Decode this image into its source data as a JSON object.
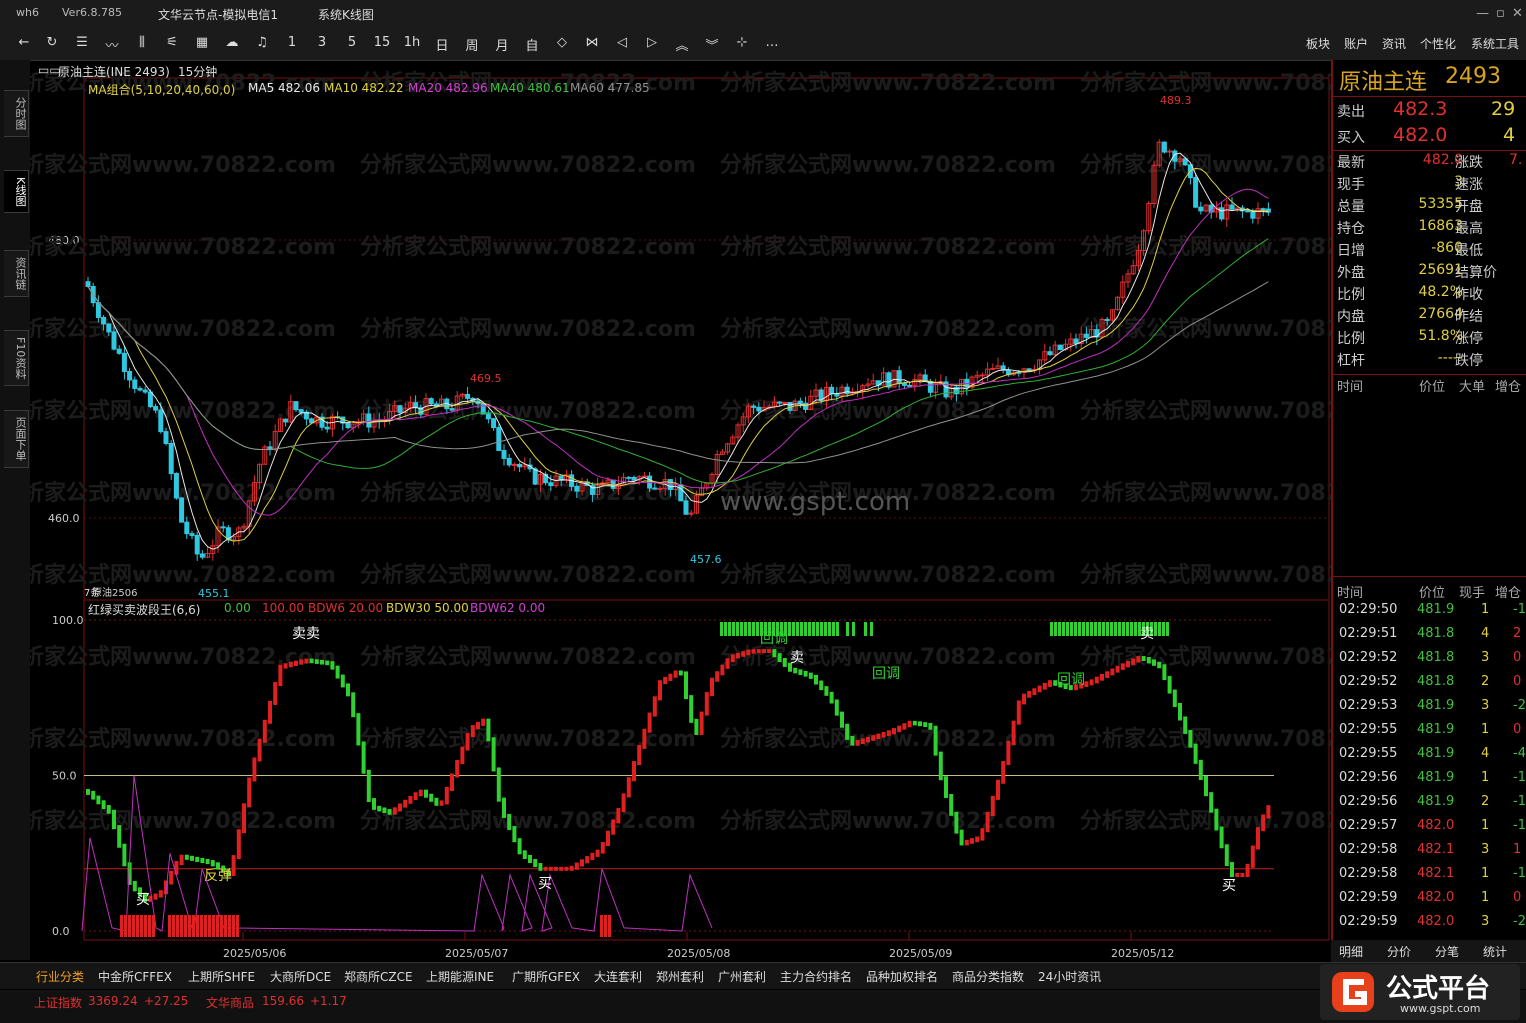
{
  "titlebar": {
    "app": "wh6",
    "version": "Ver6.8.785",
    "server": "文华云节点-模拟电信1",
    "window": "系统K线图"
  },
  "toolbar": {
    "icons": [
      "back-icon",
      "refresh-icon",
      "list-icon",
      "line-chart-icon",
      "candle-icon",
      "tick-icon",
      "grid-icon",
      "cloud-icon",
      "bell-icon"
    ],
    "periods": [
      "1",
      "3",
      "5",
      "15",
      "1h",
      "日",
      "周",
      "月",
      "自"
    ],
    "menu": [
      "板块",
      "账户",
      "资讯",
      "个性化",
      "系统工具"
    ]
  },
  "sidetabs": [
    "分时图",
    "K线图",
    "资讯链",
    "F10资料",
    "页面下单"
  ],
  "chart": {
    "symbol": "原油主连(INE 2493)",
    "period": "15分钟",
    "ma_header": "MA组合(5,10,20,40,60,0)",
    "ma": [
      {
        "label": "MA5 482.06",
        "color": "#e8e8e8"
      },
      {
        "label": "MA10 482.22",
        "color": "#e0d040"
      },
      {
        "label": "MA20 482.96",
        "color": "#d040d0"
      },
      {
        "label": "MA40 480.61",
        "color": "#40c040"
      },
      {
        "label": "MA60 477.85",
        "color": "#909090"
      }
    ],
    "price_labels": [
      "480.0",
      "460.0"
    ],
    "annotations": [
      "489.3",
      "469.5",
      "455.1",
      "457.6"
    ],
    "sub_symbol": "原油2506",
    "sub_prefix": "7条",
    "watermark": "www.gspt.com",
    "watermark_bg": "分析家公式网www.70822.com"
  },
  "indicator": {
    "name": "红绿买卖波段王(6,6)",
    "values": [
      {
        "label": "0.00",
        "color": "#40c040"
      },
      {
        "label": "100.00",
        "color": "#e03030"
      },
      {
        "label": "BDW6 20.00",
        "color": "#e03030"
      },
      {
        "label": "BDW30 50.00",
        "color": "#e0d040"
      },
      {
        "label": "BDW62 0.00",
        "color": "#d040d0"
      }
    ],
    "levels": [
      "100.0",
      "50.0",
      "0.0"
    ],
    "signals": [
      "卖卖",
      "卖",
      "回调",
      "回调",
      "回调",
      "卖",
      "买",
      "反弹",
      "买",
      "买"
    ]
  },
  "dates": [
    "2025/05/06",
    "2025/05/07",
    "2025/05/08",
    "2025/05/09",
    "2025/05/12"
  ],
  "quote": {
    "title": "原油主连",
    "code": "2493",
    "sell": {
      "label": "卖出",
      "price": "482.3",
      "vol": "29"
    },
    "buy": {
      "label": "买入",
      "price": "482.0",
      "vol": "4"
    },
    "rows": [
      {
        "l": "最新",
        "v": "482.0",
        "vc": "#e03030",
        "l2": "涨跌",
        "v2": "7."
      },
      {
        "l": "现手",
        "v": "3",
        "vc": "#e0d040",
        "l2": "速涨",
        "v2": ""
      },
      {
        "l": "总量",
        "v": "53355",
        "vc": "#e0d040",
        "l2": "开盘",
        "v2": ""
      },
      {
        "l": "持仓",
        "v": "16863",
        "vc": "#e0d040",
        "l2": "最高",
        "v2": ""
      },
      {
        "l": "日增",
        "v": "-860",
        "vc": "#e0d040",
        "l2": "最低",
        "v2": ""
      },
      {
        "l": "外盘",
        "v": "25691",
        "vc": "#e0d040",
        "l2": "结算价",
        "v2": ""
      },
      {
        "l": "比例",
        "v": "48.2%",
        "vc": "#e0d040",
        "l2": "昨收",
        "v2": ""
      },
      {
        "l": "内盘",
        "v": "27664",
        "vc": "#e0d040",
        "l2": "昨结",
        "v2": ""
      },
      {
        "l": "比例",
        "v": "51.8%",
        "vc": "#e0d040",
        "l2": "涨停",
        "v2": ""
      },
      {
        "l": "杠杆",
        "v": "-----",
        "vc": "#e0d040",
        "l2": "跌停",
        "v2": ""
      }
    ],
    "hdr1": [
      "时间",
      "价位",
      "大单",
      "增仓"
    ],
    "hdr2": [
      "时间",
      "价位",
      "现手",
      "增仓"
    ],
    "ticks": [
      [
        "02:29:50",
        "481.9",
        "1",
        "-1"
      ],
      [
        "02:29:51",
        "481.8",
        "4",
        "2"
      ],
      [
        "02:29:52",
        "481.8",
        "3",
        "0"
      ],
      [
        "02:29:52",
        "481.8",
        "2",
        "0"
      ],
      [
        "02:29:53",
        "481.9",
        "3",
        "-2"
      ],
      [
        "02:29:55",
        "481.9",
        "1",
        "0"
      ],
      [
        "02:29:55",
        "481.9",
        "4",
        "-4"
      ],
      [
        "02:29:56",
        "481.9",
        "1",
        "-1"
      ],
      [
        "02:29:56",
        "481.9",
        "2",
        "-1"
      ],
      [
        "02:29:57",
        "482.0",
        "1",
        "-1"
      ],
      [
        "02:29:58",
        "482.1",
        "3",
        "1"
      ],
      [
        "02:29:58",
        "482.1",
        "1",
        "-1"
      ],
      [
        "02:29:59",
        "482.0",
        "1",
        "0"
      ],
      [
        "02:29:59",
        "482.0",
        "3",
        "-2"
      ]
    ],
    "tabs": [
      "明细",
      "分价",
      "分笔",
      "统计"
    ]
  },
  "bottomtabs": [
    "行业分类",
    "中金所CFFEX",
    "上期所SHFE",
    "大商所DCE",
    "郑商所CZCE",
    "上期能源INE",
    "广期所GFEX",
    "大连套利",
    "郑州套利",
    "广州套利",
    "主力合约排名",
    "品种加权排名",
    "商品分类指数",
    "24小时资讯"
  ],
  "status": {
    "idx1_name": "上证指数",
    "idx1_val": "3369.24",
    "idx1_chg": "+27.25",
    "idx2_name": "文华商品",
    "idx2_val": "159.66",
    "idx2_chg": "+1.17"
  },
  "logo": {
    "text": "公式平台",
    "url": "www.gspt.com"
  }
}
